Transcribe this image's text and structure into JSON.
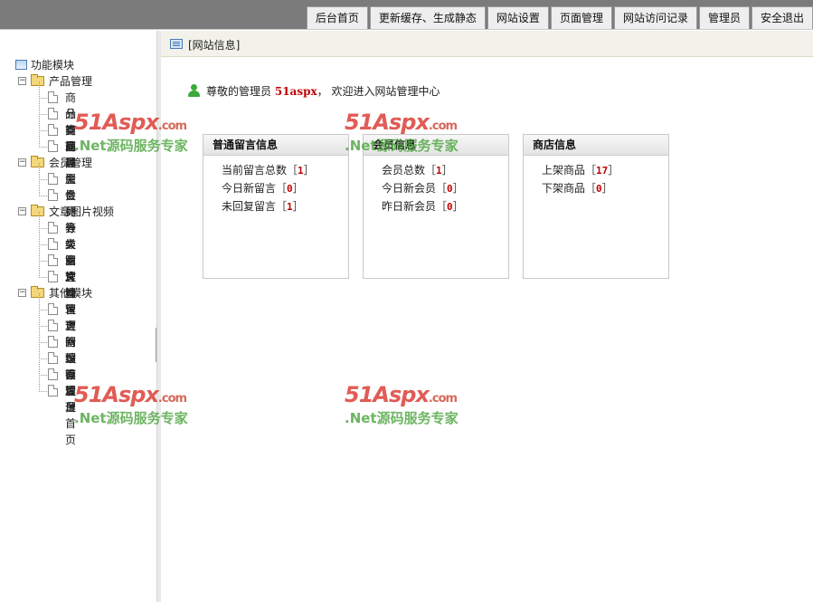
{
  "topnav": {
    "items": [
      "后台首页",
      "更新缓存、生成静态",
      "网站设置",
      "页面管理",
      "网站访问记录",
      "管理员",
      "安全退出"
    ]
  },
  "sidebar": {
    "root_label": "功能模块",
    "groups": [
      {
        "label": "产品管理",
        "items": [
          "商品管理",
          "分类管理",
          "商品类型",
          "商品属性"
        ]
      },
      {
        "label": "会员管理",
        "items": [
          "会员列表",
          "会员等级"
        ]
      },
      {
        "label": "文章图片视频",
        "items": [
          "分类管理",
          "文章管理",
          "图片管理",
          "文档管理"
        ]
      },
      {
        "label": "其他模块",
        "items": [
          "留言管理",
          "更新缓存",
          "网站设置",
          "页面管理",
          "管理员",
          "后台首页"
        ]
      }
    ]
  },
  "breadcrumb": {
    "text": "[网站信息]"
  },
  "welcome": {
    "prefix": "尊敬的管理员",
    "username": "51aspx",
    "suffix": "，  欢迎进入网站管理中心"
  },
  "panels": [
    {
      "title": "普通留言信息",
      "stats": [
        {
          "label": "当前留言总数",
          "value": "1"
        },
        {
          "label": "今日新留言",
          "value": "0"
        },
        {
          "label": "未回复留言",
          "value": "1"
        }
      ]
    },
    {
      "title": "会员信息",
      "stats": [
        {
          "label": "会员总数",
          "value": "1"
        },
        {
          "label": "今日新会员",
          "value": "0"
        },
        {
          "label": "昨日新会员",
          "value": "0"
        }
      ]
    },
    {
      "title": "商店信息",
      "stats": [
        {
          "label": "上架商品",
          "value": "17"
        },
        {
          "label": "下架商品",
          "value": "0"
        }
      ]
    }
  ],
  "watermark": {
    "logo": "51Aspx",
    "domain": ".com",
    "tagline": ".Net源码服务专家"
  },
  "colors": {
    "topbar": "#7b7b7b",
    "stat_value": "#c00000",
    "watermark_red": "#d9342b",
    "watermark_green": "#49a33b"
  }
}
